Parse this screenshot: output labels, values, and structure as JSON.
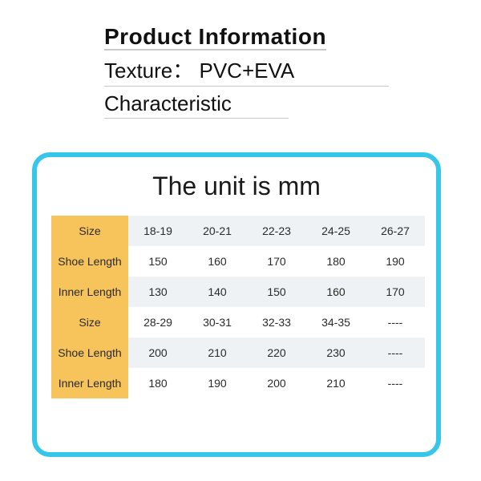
{
  "header": {
    "title": "Product Information",
    "texture_line": "Texture： PVC+EVA",
    "characteristic_label": "Characteristic"
  },
  "chart_data": {
    "type": "table",
    "title": "The unit is mm",
    "row_labels": [
      "Size",
      "Shoe Length",
      "Inner Length",
      "Size",
      "Shoe Length",
      "Inner Length"
    ],
    "rows": [
      [
        "18-19",
        "20-21",
        "22-23",
        "24-25",
        "26-27"
      ],
      [
        "150",
        "160",
        "170",
        "180",
        "190"
      ],
      [
        "130",
        "140",
        "150",
        "160",
        "170"
      ],
      [
        "28-29",
        "30-31",
        "32-33",
        "34-35",
        "----"
      ],
      [
        "200",
        "210",
        "220",
        "230",
        "----"
      ],
      [
        "180",
        "190",
        "200",
        "210",
        "----"
      ]
    ]
  }
}
